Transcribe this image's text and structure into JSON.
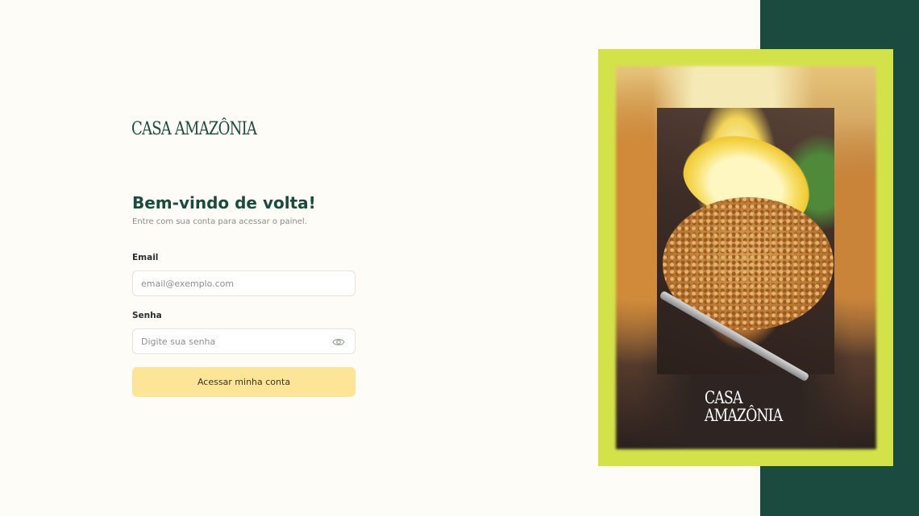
{
  "brand": {
    "logo": "CASA AMAZÔNIA",
    "photo_logo_line1": "CASA",
    "photo_logo_line2": "AMAZÔNIA"
  },
  "login": {
    "title": "Bem-vindo de volta!",
    "subtitle": "Entre com sua conta para acessar o painel.",
    "email_label": "Email",
    "email_placeholder": "email@exemplo.com",
    "email_value": "",
    "password_label": "Senha",
    "password_placeholder": "Digite sua senha",
    "password_value": "",
    "password_toggle_icon": "eye-icon",
    "submit_label": "Acessar minha conta"
  },
  "colors": {
    "brand_green": "#1b4a3e",
    "button_yellow": "#fde597",
    "frame_lime": "#d4e24a",
    "page_background": "#fdfcf6"
  }
}
